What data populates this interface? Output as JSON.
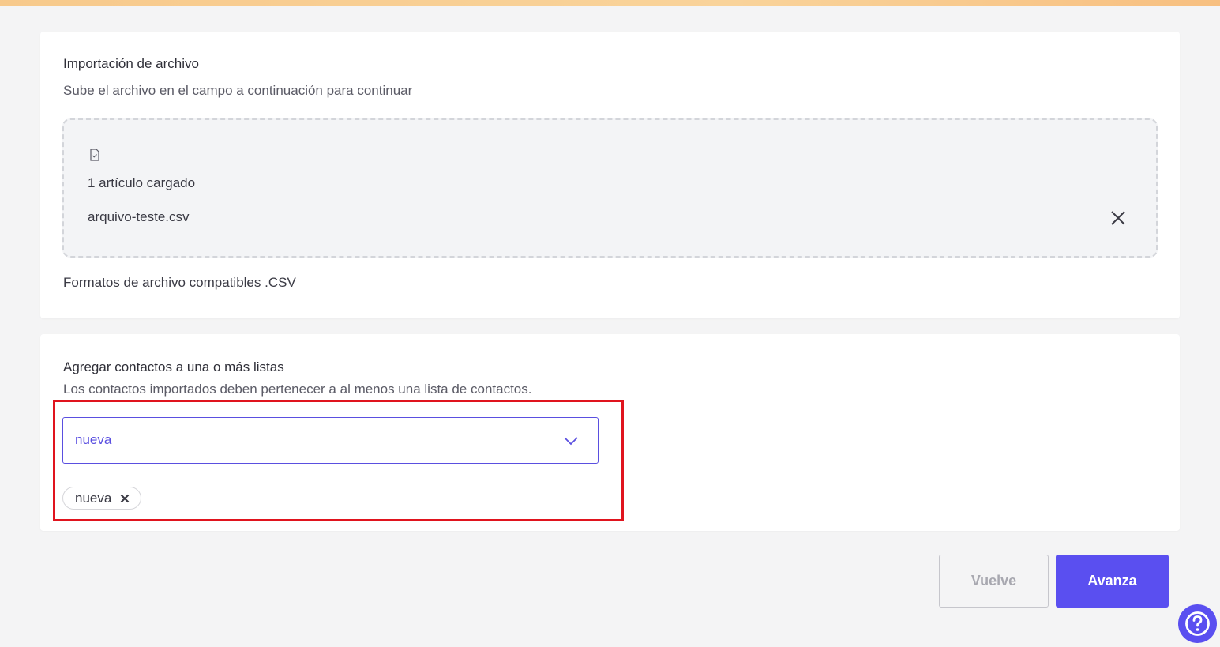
{
  "upload": {
    "title": "Importación de archivo",
    "subtitle": "Sube el archivo en el campo a continuación para continuar",
    "file_icon": "file-check-icon",
    "uploaded_count": "1 artículo cargado",
    "file_name": "arquivo-teste.csv",
    "remove_icon": "close-icon",
    "formats_note": "Formatos de archivo compatibles .CSV"
  },
  "lists": {
    "title": "Agregar contactos a una o más listas",
    "subtitle": "Los contactos importados deben pertenecer a al menos una lista de contactos.",
    "select_value": "nueva",
    "select_icon": "chevron-down-icon",
    "chips": [
      {
        "label": "nueva",
        "remove_icon": "close-icon"
      }
    ]
  },
  "actions": {
    "back_label": "Vuelve",
    "next_label": "Avanza",
    "help_icon": "question-circle-icon"
  },
  "colors": {
    "accent": "#5a4ff0",
    "highlight": "#e0141e",
    "top_bar": "#f9d39a"
  }
}
